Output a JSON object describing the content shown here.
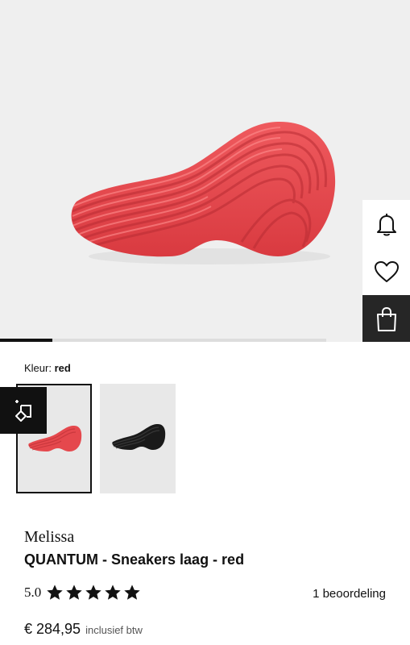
{
  "gallery": {
    "slide_progress": 0.16
  },
  "side_actions": [
    {
      "icon": "bell-icon"
    },
    {
      "icon": "heart-icon"
    },
    {
      "icon": "shopping-bag-icon"
    }
  ],
  "color": {
    "label": "Kleur:",
    "value": "red"
  },
  "thumbnails": [
    {
      "variant": "red",
      "selected": true,
      "color": "#e5484d"
    },
    {
      "variant": "black",
      "selected": false,
      "color": "#1a1a1a"
    }
  ],
  "ar_badge": {
    "icon": "ar-view-icon"
  },
  "product": {
    "brand": "Melissa",
    "title": "QUANTUM - Sneakers laag - red",
    "rating_score": "5.0",
    "stars": 5,
    "reviews": "1 beoordeling",
    "price": "€ 284,95",
    "vat_note": "inclusief btw"
  },
  "colors": {
    "shoe_red": "#e5484d",
    "dark": "#262626",
    "hero_bg": "#efefef"
  }
}
